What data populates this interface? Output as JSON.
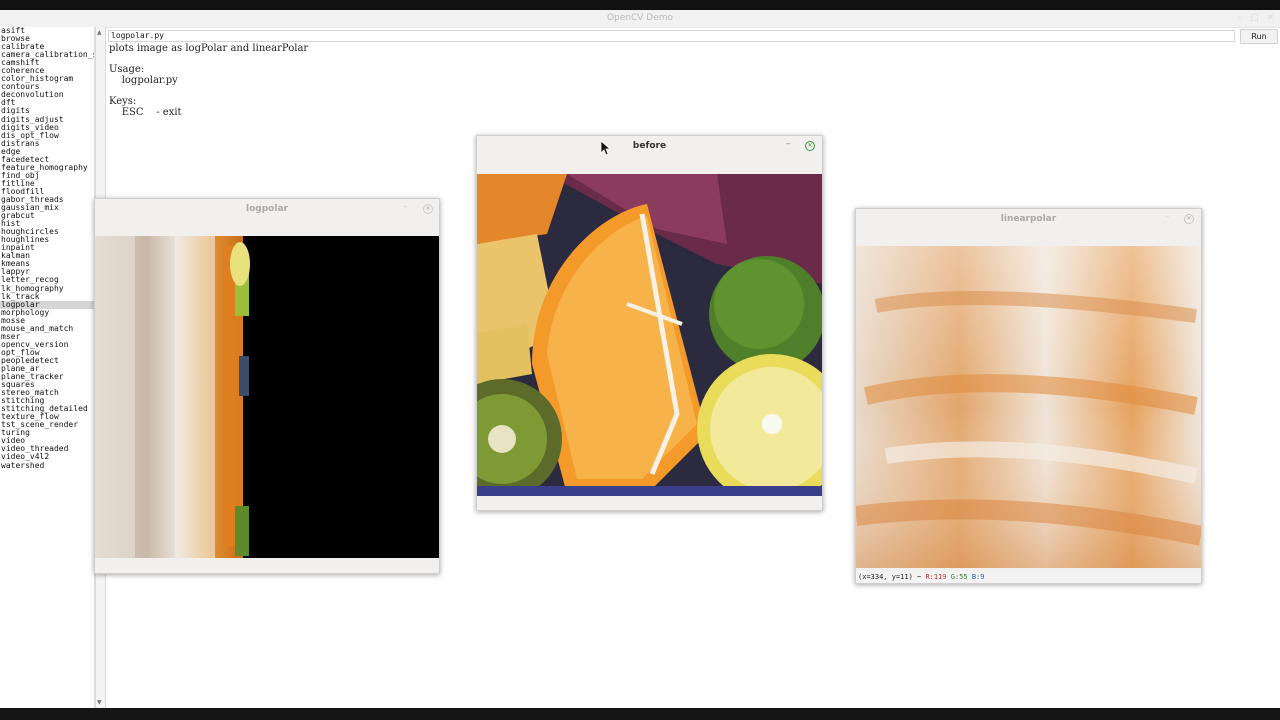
{
  "app": {
    "title": "OpenCV Demo"
  },
  "sidebar": {
    "selected": "logpolar",
    "items": [
      "asift",
      "browse",
      "calibrate",
      "camera_calibration_s",
      "camshift",
      "coherence",
      "color_histogram",
      "contours",
      "deconvolution",
      "dft",
      "digits",
      "digits_adjust",
      "digits_video",
      "dis_opt_flow",
      "distrans",
      "edge",
      "facedetect",
      "feature_homography",
      "find_obj",
      "fitline",
      "floodfill",
      "gabor_threads",
      "gaussian_mix",
      "grabcut",
      "hist",
      "houghcircles",
      "houghlines",
      "inpaint",
      "kalman",
      "kmeans",
      "lappyr",
      "letter_recog",
      "lk_homography",
      "lk_track",
      "logpolar",
      "morphology",
      "mosse",
      "mouse_and_match",
      "mser",
      "opencv_version",
      "opt_flow",
      "peopledetect",
      "plane_ar",
      "plane_tracker",
      "squares",
      "stereo_match",
      "stitching",
      "stitching_detailed",
      "texture_flow",
      "tst_scene_render",
      "turing",
      "video",
      "video_threaded",
      "video_v4l2",
      "watershed"
    ]
  },
  "toolbar": {
    "file": "logpolar.py",
    "run_label": "Run"
  },
  "description": {
    "lines": [
      "plots image as logPolar and linearPolar",
      "",
      "Usage:",
      "    logpolar.py",
      "",
      "Keys:",
      "    ESC    - exit"
    ]
  },
  "windows": {
    "logpolar": {
      "title": "logpolar"
    },
    "before": {
      "title": "before"
    },
    "linearpolar": {
      "title": "linearpolar",
      "status_pos": "(x=334, y=11) ~ ",
      "status_r": "R:119",
      "status_g": "G:55",
      "status_b": "B:9",
      "status_colors": {
        "r": "#c62828",
        "g": "#2e7d32",
        "b": "#1565c0"
      }
    }
  }
}
